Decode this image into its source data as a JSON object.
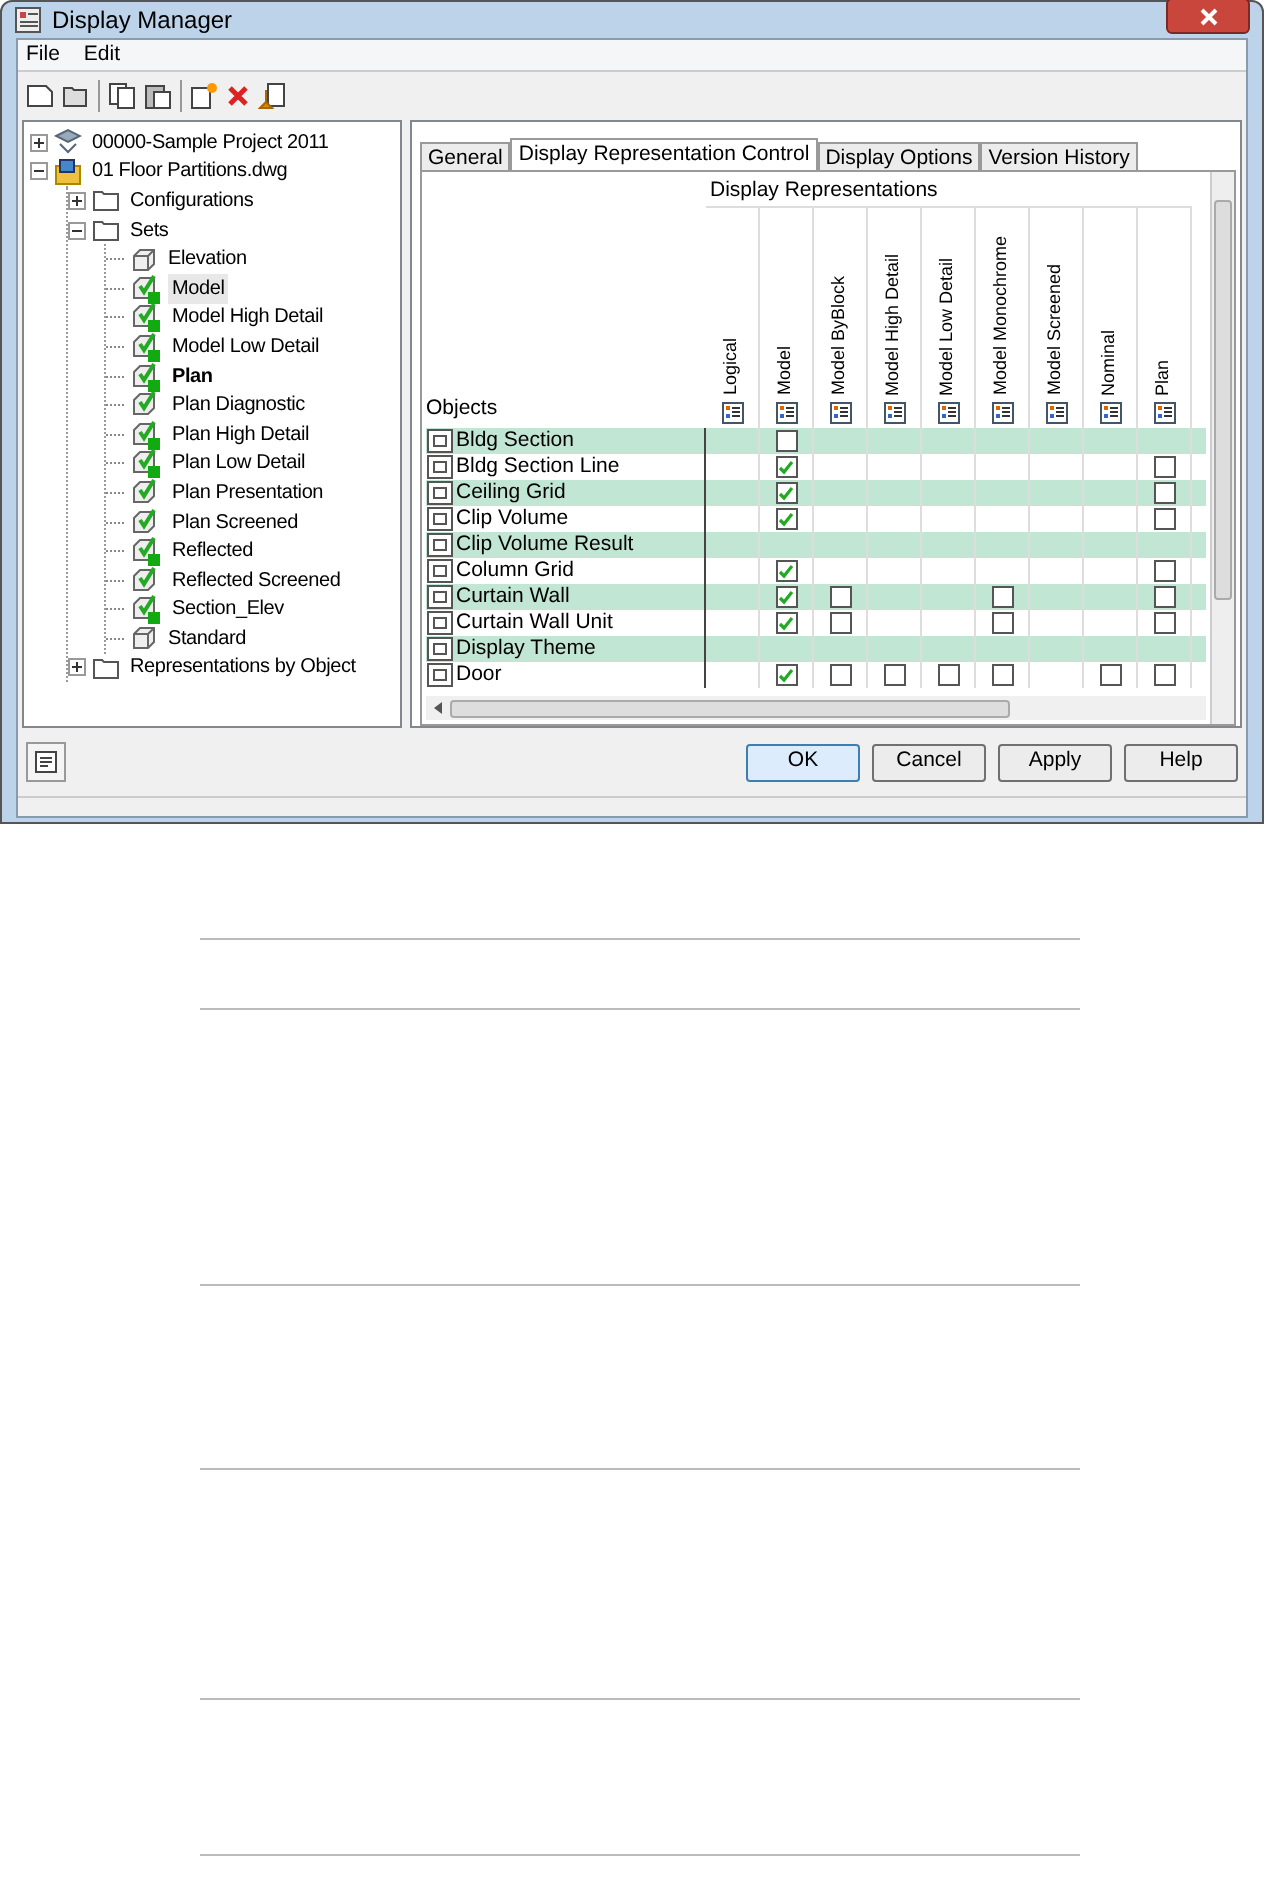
{
  "window": {
    "title": "Display Manager"
  },
  "menu": [
    "File",
    "Edit"
  ],
  "tree": [
    {
      "label": "00000-Sample Project 2011",
      "kind": "project",
      "expanded": false,
      "bold": false,
      "selected": false
    },
    {
      "label": "01 Floor Partitions.dwg",
      "kind": "drawing",
      "expanded": true,
      "bold": false,
      "selected": false,
      "children": [
        {
          "label": "Configurations",
          "kind": "folder",
          "expanded": false,
          "bold": false,
          "selected": false
        },
        {
          "label": "Sets",
          "kind": "folder",
          "expanded": true,
          "bold": false,
          "selected": false,
          "children": [
            {
              "label": "Elevation",
              "kind": "plain",
              "bold": false,
              "selected": false
            },
            {
              "label": "Model",
              "kind": "in-use",
              "bold": false,
              "selected": true
            },
            {
              "label": "Model High Detail",
              "kind": "in-use",
              "bold": false,
              "selected": false
            },
            {
              "label": "Model Low Detail",
              "kind": "in-use",
              "bold": false,
              "selected": false
            },
            {
              "label": "Plan",
              "kind": "in-use",
              "bold": true,
              "selected": false
            },
            {
              "label": "Plan Diagnostic",
              "kind": "set",
              "bold": false,
              "selected": false
            },
            {
              "label": "Plan High Detail",
              "kind": "in-use",
              "bold": false,
              "selected": false
            },
            {
              "label": "Plan Low Detail",
              "kind": "in-use",
              "bold": false,
              "selected": false
            },
            {
              "label": "Plan Presentation",
              "kind": "set",
              "bold": false,
              "selected": false
            },
            {
              "label": "Plan Screened",
              "kind": "set",
              "bold": false,
              "selected": false
            },
            {
              "label": "Reflected",
              "kind": "in-use",
              "bold": false,
              "selected": false
            },
            {
              "label": "Reflected Screened",
              "kind": "set",
              "bold": false,
              "selected": false
            },
            {
              "label": "Section_Elev",
              "kind": "in-use",
              "bold": false,
              "selected": false
            },
            {
              "label": "Standard",
              "kind": "plain",
              "bold": false,
              "selected": false
            }
          ]
        },
        {
          "label": "Representations by Object",
          "kind": "folder",
          "expanded": false,
          "bold": false,
          "selected": false
        }
      ]
    }
  ],
  "tabs": [
    {
      "label": "General",
      "selected": false
    },
    {
      "label": "Display Representation Control",
      "selected": true
    },
    {
      "label": "Display Options",
      "selected": false
    },
    {
      "label": "Version History",
      "selected": false
    }
  ],
  "grid": {
    "group_header": "Display Representations",
    "objects_header": "Objects",
    "columns": [
      "Logical",
      "Model",
      "Model ByBlock",
      "Model High Detail",
      "Model Low Detail",
      "Model Monochrome",
      "Model Screened",
      "Nominal",
      "Plan"
    ],
    "rows": [
      {
        "name": "Bldg Section",
        "cells": [
          {
            "kind": "empty"
          },
          {
            "kind": "checkbox",
            "checked": false
          },
          {
            "kind": "empty"
          },
          {
            "kind": "empty"
          },
          {
            "kind": "empty"
          },
          {
            "kind": "empty"
          },
          {
            "kind": "empty"
          },
          {
            "kind": "empty"
          },
          {
            "kind": "empty"
          }
        ]
      },
      {
        "name": "Bldg Section Line",
        "cells": [
          {
            "kind": "empty"
          },
          {
            "kind": "checkbox",
            "checked": true
          },
          {
            "kind": "empty"
          },
          {
            "kind": "empty"
          },
          {
            "kind": "empty"
          },
          {
            "kind": "empty"
          },
          {
            "kind": "empty"
          },
          {
            "kind": "empty"
          },
          {
            "kind": "checkbox",
            "checked": false
          }
        ]
      },
      {
        "name": "Ceiling Grid",
        "cells": [
          {
            "kind": "empty"
          },
          {
            "kind": "checkbox",
            "checked": true
          },
          {
            "kind": "empty"
          },
          {
            "kind": "empty"
          },
          {
            "kind": "empty"
          },
          {
            "kind": "empty"
          },
          {
            "kind": "empty"
          },
          {
            "kind": "empty"
          },
          {
            "kind": "checkbox",
            "checked": false
          }
        ]
      },
      {
        "name": "Clip Volume",
        "cells": [
          {
            "kind": "empty"
          },
          {
            "kind": "checkbox",
            "checked": true
          },
          {
            "kind": "empty"
          },
          {
            "kind": "empty"
          },
          {
            "kind": "empty"
          },
          {
            "kind": "empty"
          },
          {
            "kind": "empty"
          },
          {
            "kind": "empty"
          },
          {
            "kind": "checkbox",
            "checked": false
          }
        ]
      },
      {
        "name": "Clip Volume Result",
        "cells": [
          {
            "kind": "empty"
          },
          {
            "kind": "empty"
          },
          {
            "kind": "empty"
          },
          {
            "kind": "empty"
          },
          {
            "kind": "empty"
          },
          {
            "kind": "empty"
          },
          {
            "kind": "empty"
          },
          {
            "kind": "empty"
          },
          {
            "kind": "empty"
          }
        ]
      },
      {
        "name": "Column Grid",
        "cells": [
          {
            "kind": "empty"
          },
          {
            "kind": "checkbox",
            "checked": true
          },
          {
            "kind": "empty"
          },
          {
            "kind": "empty"
          },
          {
            "kind": "empty"
          },
          {
            "kind": "empty"
          },
          {
            "kind": "empty"
          },
          {
            "kind": "empty"
          },
          {
            "kind": "checkbox",
            "checked": false
          }
        ]
      },
      {
        "name": "Curtain Wall",
        "cells": [
          {
            "kind": "empty"
          },
          {
            "kind": "checkbox",
            "checked": true
          },
          {
            "kind": "checkbox",
            "checked": false
          },
          {
            "kind": "empty"
          },
          {
            "kind": "empty"
          },
          {
            "kind": "checkbox",
            "checked": false
          },
          {
            "kind": "empty"
          },
          {
            "kind": "empty"
          },
          {
            "kind": "checkbox",
            "checked": false
          }
        ]
      },
      {
        "name": "Curtain Wall Unit",
        "cells": [
          {
            "kind": "empty"
          },
          {
            "kind": "checkbox",
            "checked": true
          },
          {
            "kind": "checkbox",
            "checked": false
          },
          {
            "kind": "empty"
          },
          {
            "kind": "empty"
          },
          {
            "kind": "checkbox",
            "checked": false
          },
          {
            "kind": "empty"
          },
          {
            "kind": "empty"
          },
          {
            "kind": "checkbox",
            "checked": false
          }
        ]
      },
      {
        "name": "Display Theme",
        "cells": [
          {
            "kind": "empty"
          },
          {
            "kind": "empty"
          },
          {
            "kind": "empty"
          },
          {
            "kind": "empty"
          },
          {
            "kind": "empty"
          },
          {
            "kind": "empty"
          },
          {
            "kind": "empty"
          },
          {
            "kind": "empty"
          },
          {
            "kind": "empty"
          }
        ]
      },
      {
        "name": "Door",
        "cells": [
          {
            "kind": "empty"
          },
          {
            "kind": "checkbox",
            "checked": true
          },
          {
            "kind": "checkbox",
            "checked": false
          },
          {
            "kind": "checkbox",
            "checked": false
          },
          {
            "kind": "checkbox",
            "checked": false
          },
          {
            "kind": "checkbox",
            "checked": false
          },
          {
            "kind": "empty"
          },
          {
            "kind": "checkbox",
            "checked": false
          },
          {
            "kind": "checkbox",
            "checked": false
          }
        ]
      }
    ]
  },
  "buttons": [
    {
      "label": "OK",
      "default": true
    },
    {
      "label": "Cancel",
      "default": false
    },
    {
      "label": "Apply",
      "default": false
    },
    {
      "label": "Help",
      "default": false
    }
  ]
}
